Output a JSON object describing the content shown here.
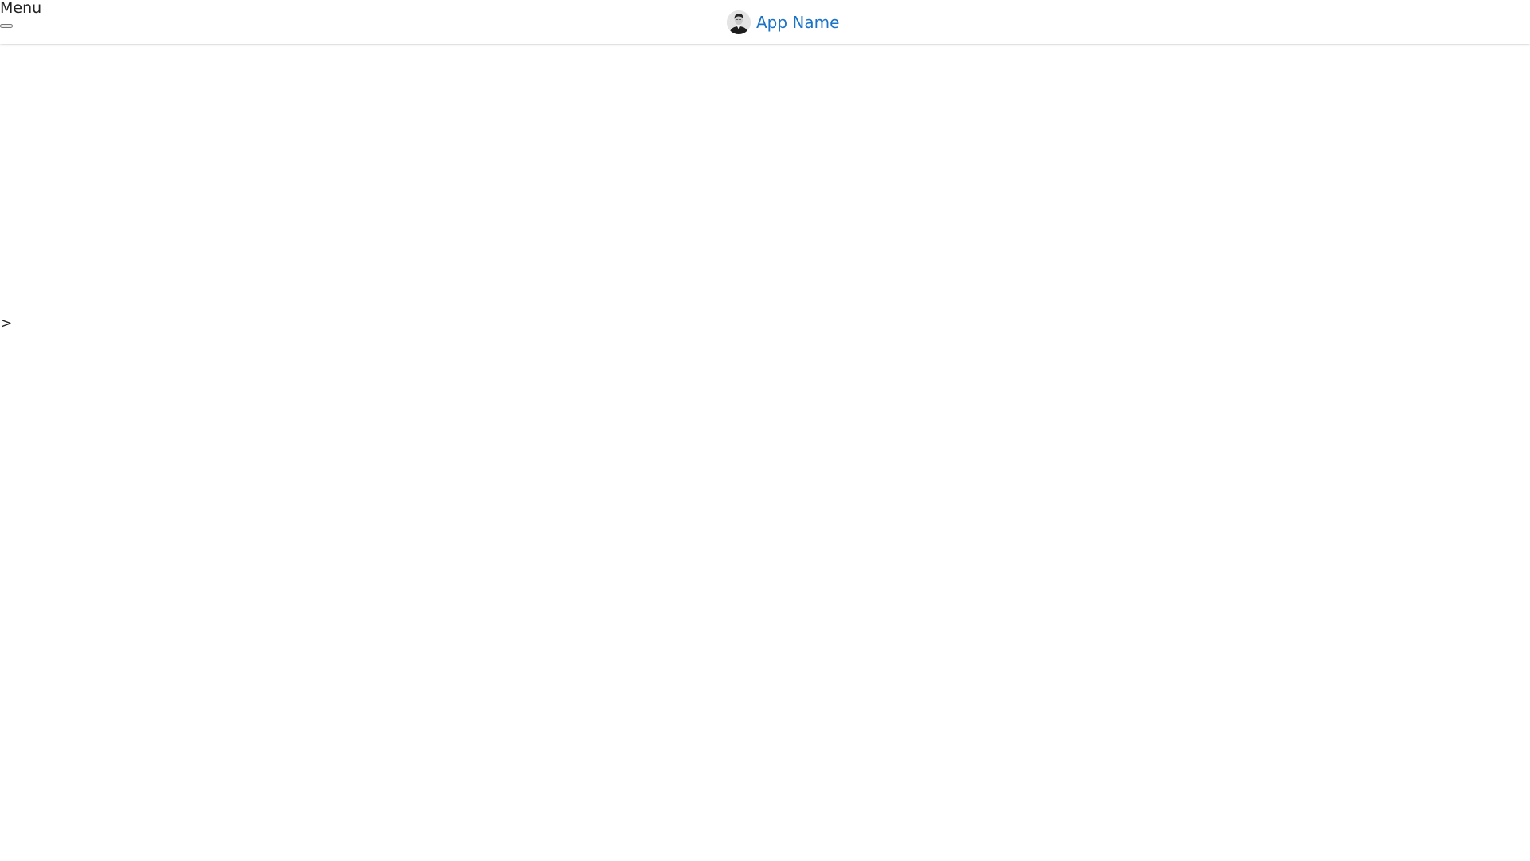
{
  "header": {
    "menu_label": "Menu",
    "app_name": "App Name",
    "avatar_icon": "user-avatar-icon"
  },
  "sidebar": {
    "expand_arrow": ">"
  },
  "colors": {
    "brand_link": "#1a73c7",
    "text": "#222222",
    "background": "#ffffff"
  }
}
